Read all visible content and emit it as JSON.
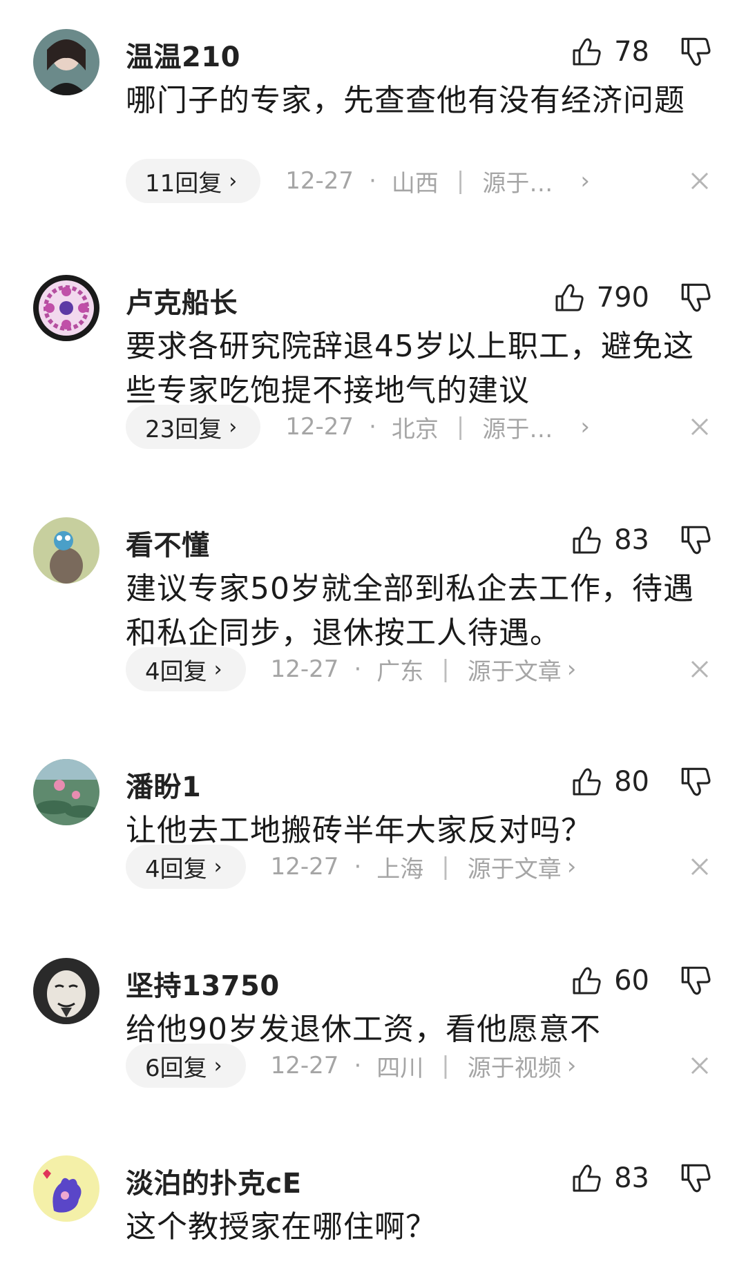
{
  "comments": [
    {
      "username": "温温210",
      "likes": "78",
      "content": "哪门子的专家，先查查他有没有经济问题",
      "replies": "11回复",
      "date": "12-27",
      "location": "山西",
      "source": "源于…"
    },
    {
      "username": "卢克船长",
      "likes": "790",
      "content": "要求各研究院辞退45岁以上职工，避免这些专家吃饱提不接地气的建议",
      "replies": "23回复",
      "date": "12-27",
      "location": "北京",
      "source": "源于…"
    },
    {
      "username": "看不懂",
      "likes": "83",
      "content": "建议专家50岁就全部到私企去工作，待遇和私企同步，退休按工人待遇。",
      "replies": "4回复",
      "date": "12-27",
      "location": "广东",
      "source": "源于文章"
    },
    {
      "username": "潘盼1",
      "likes": "80",
      "content": "让他去工地搬砖半年大家反对吗？",
      "replies": "4回复",
      "date": "12-27",
      "location": "上海",
      "source": "源于文章"
    },
    {
      "username": "坚持13750",
      "likes": "60",
      "content": "给他90岁发退休工资，看他愿意不",
      "replies": "6回复",
      "date": "12-27",
      "location": "四川",
      "source": "源于视频"
    },
    {
      "username": "淡泊的扑克cE",
      "likes": "83",
      "content": "这个教授家在哪住啊？"
    }
  ],
  "icons": {
    "like": "thumbs-up-icon",
    "dislike": "thumbs-down-icon",
    "close": "close-icon",
    "chevron": "chevron-right-icon"
  },
  "colors": {
    "text": "#1a1a1a",
    "meta": "#a5a5a5",
    "pill": "#f3f3f3"
  }
}
